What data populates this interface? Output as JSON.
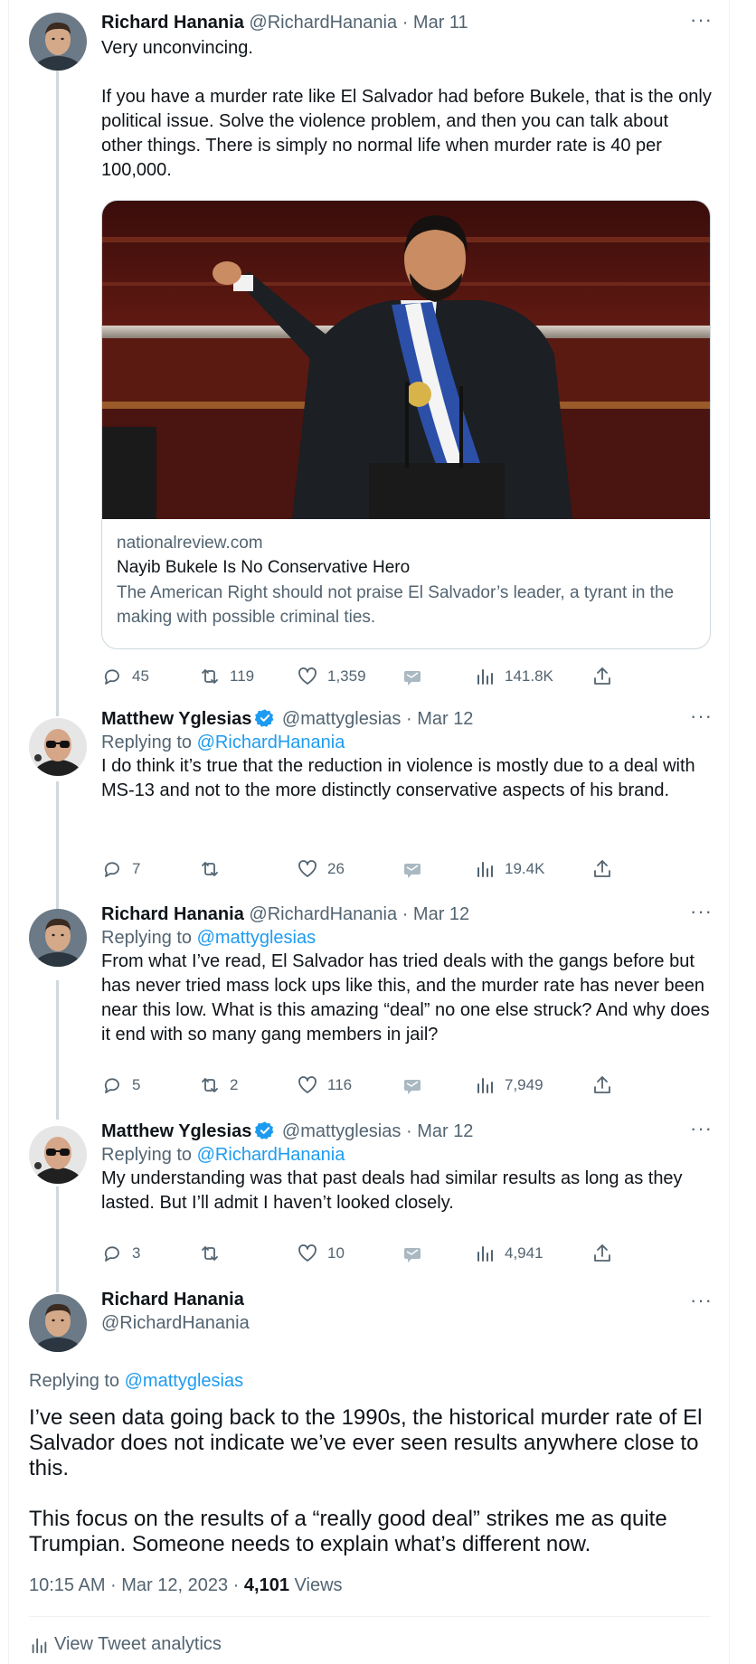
{
  "colors": {
    "accent": "#1d9bf0",
    "muted": "#536471",
    "text": "#0f1419",
    "line": "#cfd9de"
  },
  "tweets": [
    {
      "name": "Richard Hanania",
      "handle": "@RichardHanania",
      "dot": "·",
      "date": "Mar 11",
      "verified": false,
      "body": "Very unconvincing.\n\nIf you have a murder rate like El Salvador had before Bukele, that is the only political issue. Solve the violence problem, and then you can talk about other things. There is simply no normal life when murder rate is 40 per 100,000.",
      "card": {
        "domain": "nationalreview.com",
        "title": "Nayib Bukele Is No Conservative Hero",
        "description": "The American Right should not praise El Salvador’s leader, a tyrant in the making with possible criminal ties."
      },
      "replies": "45",
      "retweets": "119",
      "likes": "1,359",
      "views": "141.8K"
    },
    {
      "name": "Matthew Yglesias",
      "handle": "@mattyglesias",
      "dot": "·",
      "date": "Mar 12",
      "verified": true,
      "replying_prefix": "Replying to",
      "replying_to": "@RichardHanania",
      "body": "I do think it’s true that the reduction in violence is mostly due to a deal with MS-13 and not to the more distinctly conservative aspects of his brand.",
      "replies": "7",
      "retweets": "",
      "likes": "26",
      "views": "19.4K"
    },
    {
      "name": "Richard Hanania",
      "handle": "@RichardHanania",
      "dot": "·",
      "date": "Mar 12",
      "verified": false,
      "replying_prefix": "Replying to",
      "replying_to": "@mattyglesias",
      "body": "From what I’ve read, El Salvador has tried deals with the gangs before but has never tried mass lock ups like this, and the murder rate has never been near this low. What is this amazing “deal” no one else struck? And why does it end with so many gang members in jail?",
      "replies": "5",
      "retweets": "2",
      "likes": "116",
      "views": "7,949"
    },
    {
      "name": "Matthew Yglesias",
      "handle": "@mattyglesias",
      "dot": "·",
      "date": "Mar 12",
      "verified": true,
      "replying_prefix": "Replying to",
      "replying_to": "@RichardHanania",
      "body": "My understanding was that past deals had similar results as long as they lasted. But I’ll admit I haven’t looked closely.",
      "replies": "3",
      "retweets": "",
      "likes": "10",
      "views": "4,941"
    }
  ],
  "main": {
    "name": "Richard Hanania",
    "handle": "@RichardHanania",
    "replying_prefix": "Replying to",
    "replying_to": "@mattyglesias",
    "body": "I’ve seen data going back to the 1990s, the historical murder rate of El Salvador does not indicate we’ve ever seen results anywhere close to this.\n\nThis focus on the results of a “really good deal” strikes me as quite Trumpian. Someone needs to explain what’s different now.",
    "time": "10:15 AM · Mar 12, 2023 · ",
    "views_count": "4,101",
    "views_label": " Views",
    "analytics_label": "View Tweet analytics"
  },
  "more_icon": "···"
}
